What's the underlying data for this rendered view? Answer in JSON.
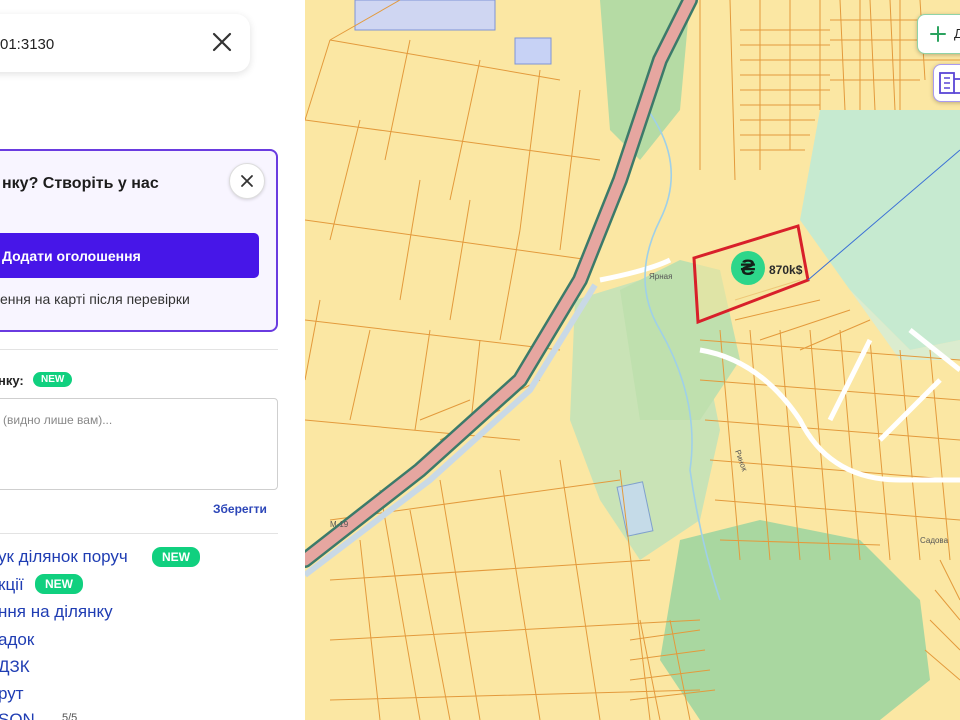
{
  "search": {
    "value": "01:3130"
  },
  "promo": {
    "title": "нку? Створіть у нас",
    "button_label": "Додати оголошення",
    "note": "ення на карті після перевірки"
  },
  "note": {
    "label": "нку:",
    "badge": "NEW",
    "placeholder": "(видно лише вам)...",
    "save_label": "Зберегти"
  },
  "links": [
    {
      "label": "ук ділянок поруч",
      "badge": "NEW"
    },
    {
      "label": "кції",
      "badge": "NEW"
    },
    {
      "label": "ння на ділянку",
      "badge": ""
    },
    {
      "label": "адок",
      "badge": ""
    },
    {
      "label": "ДЗК",
      "badge": ""
    },
    {
      "label": "рут",
      "badge": ""
    },
    {
      "label": "SON",
      "badge": ""
    }
  ],
  "pager": "5/5",
  "map": {
    "add_button_label": "Д",
    "price_symbol": "₴",
    "price_label": "870k$",
    "road_labels": [
      "M-19",
      "Ярная",
      "Ринок",
      "Садова"
    ]
  },
  "colors": {
    "accent": "#4716e8",
    "badge": "#10d07f",
    "link": "#1f3db3",
    "parcel_fill": "#fbe7a3",
    "parcel_stroke": "#e39a3c",
    "selected_parcel": "#d8202a",
    "forest": "#b9ddb0",
    "highway": "#e6a6a0"
  }
}
